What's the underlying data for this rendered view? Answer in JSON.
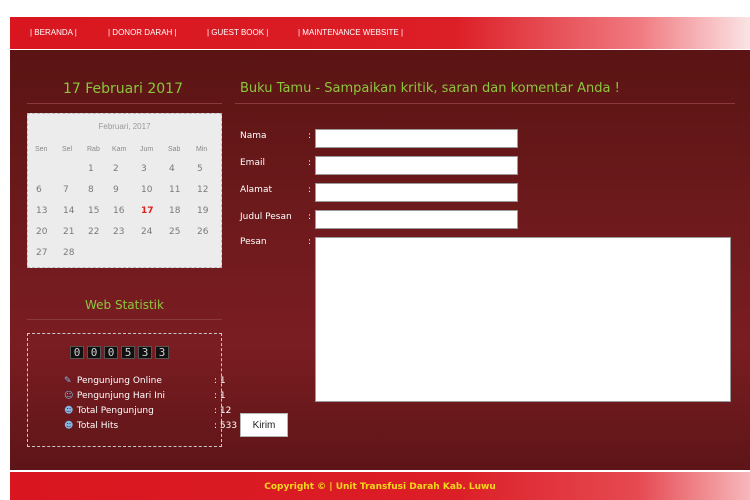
{
  "nav": {
    "items": [
      "| BERANDA |",
      "| DONOR DARAH |",
      "| GUEST BOOK |",
      "| MAINTENANCE WEBSITE |"
    ]
  },
  "sidebar": {
    "date_title": "17 Februari 2017",
    "calendar": {
      "month": "Februari, 2017",
      "weekdays": [
        "Sen",
        "Sel",
        "Rab",
        "Kam",
        "Jum",
        "Sab",
        "Min"
      ],
      "days": [
        "1",
        "2",
        "3",
        "4",
        "5",
        "6",
        "7",
        "8",
        "9",
        "10",
        "11",
        "12",
        "13",
        "14",
        "15",
        "16",
        "17",
        "18",
        "19",
        "20",
        "21",
        "22",
        "23",
        "24",
        "25",
        "26",
        "27",
        "28"
      ],
      "today": "17"
    },
    "stats": {
      "title": "Web Statistik",
      "counter": [
        "0",
        "0",
        "0",
        "5",
        "3",
        "3"
      ],
      "rows": [
        {
          "icon": "user-online-icon",
          "label": "Pengunjung Online",
          "value": ": 1"
        },
        {
          "icon": "users-today-icon",
          "label": "Pengunjung Hari Ini",
          "value": ": 1"
        },
        {
          "icon": "users-total-icon",
          "label": "Total Pengunjung",
          "value": ": 12"
        },
        {
          "icon": "hits-icon",
          "label": "Total Hits",
          "value": ": 533"
        }
      ]
    }
  },
  "guestbook": {
    "title": "Buku Tamu - Sampaikan kritik, saran dan komentar Anda !",
    "fields": {
      "nama": {
        "label": "Nama",
        "value": ""
      },
      "email": {
        "label": "Email",
        "value": ""
      },
      "alamat": {
        "label": "Alamat",
        "value": ""
      },
      "judul": {
        "label": "Judul Pesan",
        "value": ""
      },
      "pesan": {
        "label": "Pesan",
        "value": ""
      }
    },
    "colon": ":",
    "submit_label": "Kirim"
  },
  "footer": {
    "text": "Copyright © | Unit Transfusi Darah Kab. Luwu"
  },
  "colors": {
    "accent_green": "#8cc63f",
    "nav_red": "#d9161f",
    "today_red": "#e0201f",
    "footer_text": "#f2d91a"
  }
}
